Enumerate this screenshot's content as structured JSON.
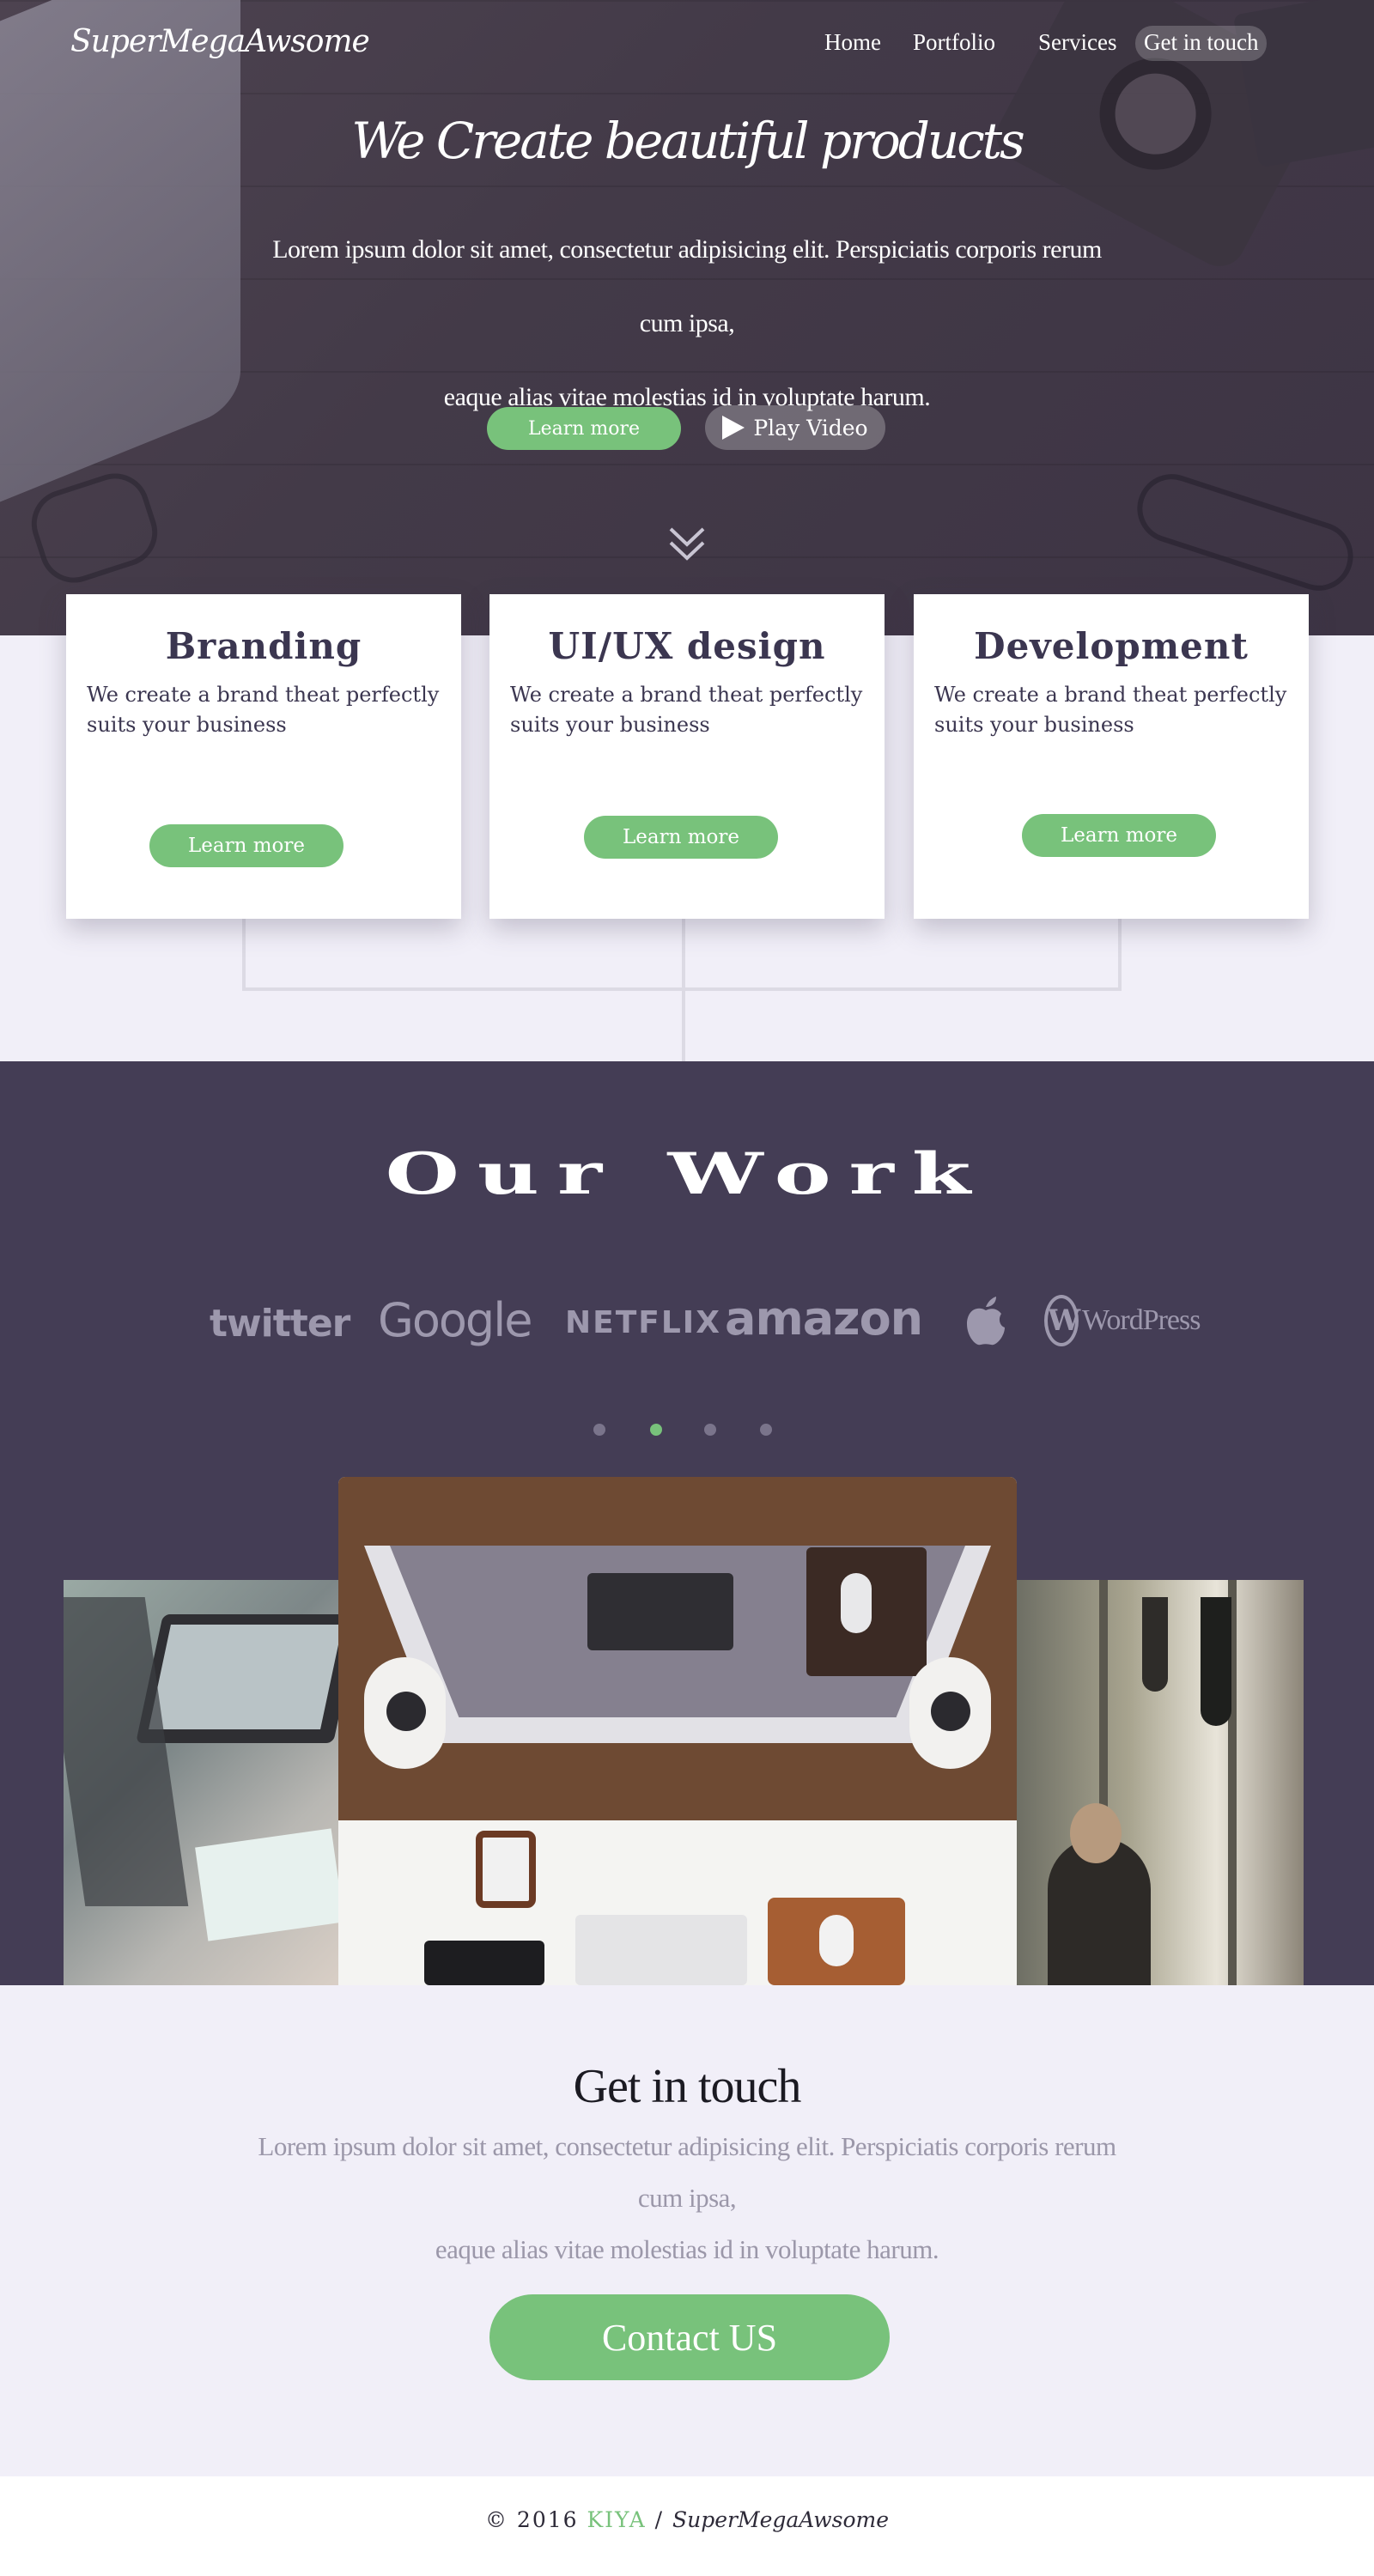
{
  "header": {
    "logo": "SuperMegaAwsome",
    "nav": [
      "Home",
      "Portfolio",
      "Services",
      "Get in touch"
    ]
  },
  "hero": {
    "title": "We Create beautiful products",
    "subtitle_line1": "Lorem ipsum dolor sit amet, consectetur adipisicing elit. Perspiciatis corporis rerum cum ipsa,",
    "subtitle_line2": "eaque alias vitae molestias id in voluptate harum.",
    "learn_more": "Learn more",
    "play_video": "Play Video"
  },
  "services": [
    {
      "title": "Branding",
      "text": "We create a brand theat perfectly suits your business",
      "button": "Learn more"
    },
    {
      "title": "UI/UX design",
      "text": "We create a brand theat perfectly suits your business",
      "button": "Learn more"
    },
    {
      "title": "Development",
      "text": "We create a brand theat perfectly suits your business",
      "button": "Learn more"
    }
  ],
  "work": {
    "title": "Our Work",
    "brands": [
      "twitter",
      "Google",
      "NETFLIX",
      "amazon",
      "apple-icon",
      "WordPress"
    ],
    "dots": [
      false,
      true,
      false,
      false
    ]
  },
  "contact": {
    "title": "Get in touch",
    "line1": "Lorem ipsum dolor sit amet, consectetur adipisicing elit. Perspiciatis corporis rerum cum ipsa,",
    "line2": "eaque alias vitae molestias id in voluptate harum.",
    "button": "Contact US"
  },
  "footer": {
    "copyright": "© 2016",
    "kiya": "KIYA",
    "separator": "/",
    "name": "SuperMegaAwsome"
  },
  "colors": {
    "accent": "#78c27b",
    "dark": "#443d55",
    "background": "#f1eff8"
  }
}
